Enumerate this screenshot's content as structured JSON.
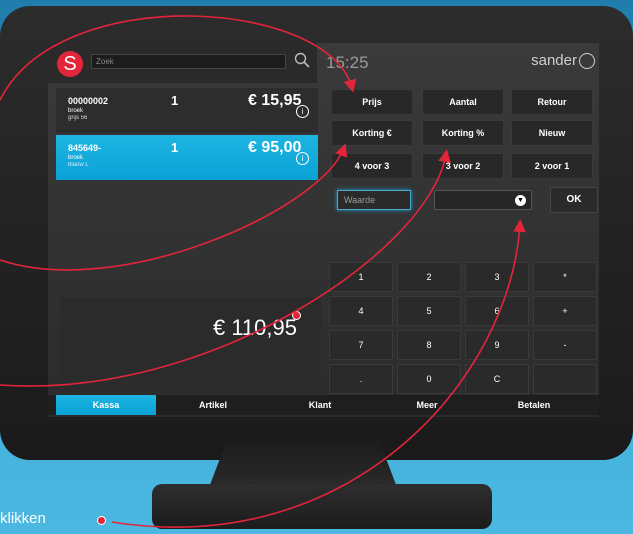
{
  "header": {
    "logo_letter": "S",
    "search_placeholder": "Zoek",
    "time": "15:25",
    "user": "sander"
  },
  "line_items": [
    {
      "code": "00000002",
      "name": "broek",
      "variant": "grijs 56",
      "qty": "1",
      "price": "€ 15,95",
      "selected": false
    },
    {
      "code": "845649-",
      "name": "broek",
      "variant": "blauw L",
      "qty": "1",
      "price": "€ 95,00",
      "selected": true
    }
  ],
  "info_glyph": "i",
  "total": "€ 110,95",
  "function_buttons": [
    "Prijs",
    "Aantal",
    "Retour",
    "Korting €",
    "Korting %",
    "Nieuw",
    "4 voor 3",
    "3 voor 2",
    "2 voor 1"
  ],
  "value_input_placeholder": "Waarde",
  "ok_label": "OK",
  "keypad": [
    "1",
    "2",
    "3",
    "*",
    "4",
    "5",
    "6",
    "+",
    "7",
    "8",
    "9",
    "-",
    ".",
    "0",
    "C",
    ""
  ],
  "tabs": [
    "Kassa",
    "Artikel",
    "Klant",
    "Meer",
    "Betalen"
  ],
  "active_tab": "Kassa",
  "caption": "klikken",
  "colors": {
    "accent": "#0aa1d6",
    "brand": "#e3253a",
    "background": "#3ea8d4"
  }
}
